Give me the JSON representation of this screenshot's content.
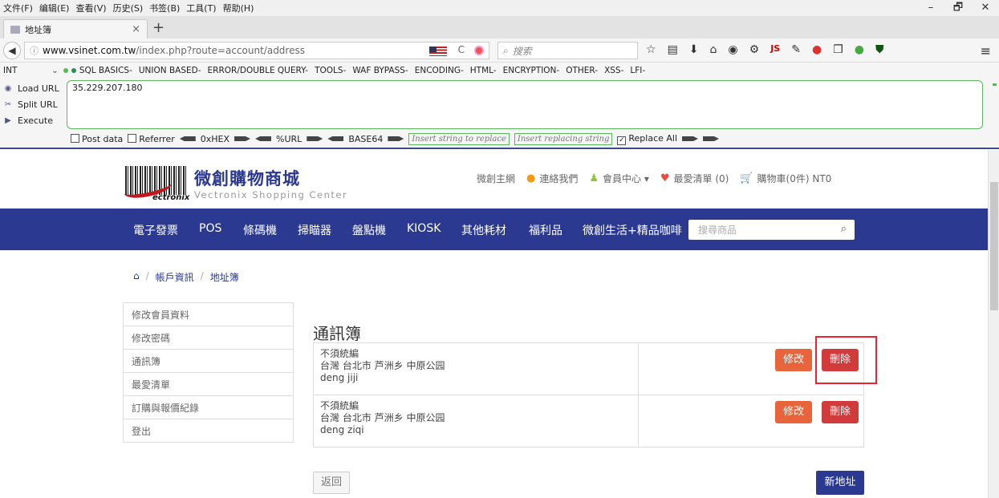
{
  "browser": {
    "menu": [
      "文件(F)",
      "编辑(E)",
      "查看(V)",
      "历史(S)",
      "书签(B)",
      "工具(T)",
      "帮助(H)"
    ],
    "window_controls": [
      "–",
      "🗗",
      "✕"
    ],
    "tab_title": "地址簿",
    "url_host": "www.vsinet.com.tw",
    "url_path": "/index.php?route=account/address",
    "search_placeholder": "搜索",
    "reload": "C",
    "toolbar_js": "JS"
  },
  "hackbar": {
    "int_label": "INT",
    "menu": [
      "SQL BASICS-",
      "UNION BASED-",
      "ERROR/DOUBLE QUERY-",
      "TOOLS-",
      "WAF BYPASS-",
      "ENCODING-",
      "HTML-",
      "ENCRYPTION-",
      "OTHER-",
      "XSS-",
      "LFI-"
    ],
    "actions": [
      "Load URL",
      "Split URL",
      "Execute"
    ],
    "url_value": "35.229.207.180",
    "post_data": "Post data",
    "referrer": "Referrer",
    "hex": "0xHEX",
    "url_enc": "%URL",
    "base64": "BASE64",
    "insert_replace": "Insert string to replace",
    "insert_replacing": "Insert replacing string",
    "replace_all": "Replace All"
  },
  "site": {
    "logo_text": "ectronix",
    "title": "微創購物商城",
    "subtitle": "Vectronix Shopping Center",
    "top_links": {
      "main": "微創主網",
      "contact": "連絡我們",
      "member": "會員中心 ▾",
      "wishlist": "最愛清單 (0)",
      "cart": "購物車(0件) NT0"
    },
    "nav": [
      "電子發票",
      "POS",
      "條碼機",
      "掃瞄器",
      "盤點機",
      "KIOSK",
      "其他耗材",
      "福利品",
      "微創生活+精品咖啡"
    ],
    "search_placeholder": "搜尋商品",
    "breadcrumb": [
      "帳戶資訊",
      "地址簿"
    ],
    "sidebar": [
      "修改會員資料",
      "修改密碼",
      "通訊簿",
      "最愛清單",
      "訂購與報價紀錄",
      "登出"
    ],
    "section_title": "通訊簿",
    "addresses": [
      {
        "line1": "不須統編",
        "line2": "台灣 台北市 芦洲乡 中原公园",
        "line3": "deng jiji"
      },
      {
        "line1": "不須統編",
        "line2": "台灣 台北市 芦洲乡 中原公园",
        "line3": "deng ziqi"
      }
    ],
    "edit_label": "修改",
    "delete_label": "刪除",
    "back_label": "返回",
    "new_address_label": "新地址"
  },
  "colors": {
    "brand": "#2b3990",
    "edit": "#e8643a",
    "delete": "#d13b3b",
    "highlight": "#e22233"
  }
}
